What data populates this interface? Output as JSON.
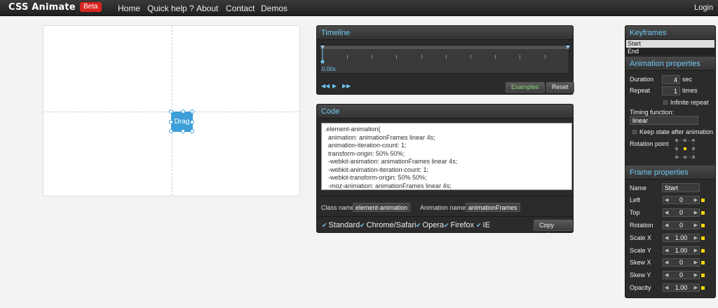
{
  "header": {
    "logo": "CSS Animate",
    "badge": "Beta",
    "nav": [
      "Home",
      "Quick help ?",
      "About",
      "Contact",
      "Demos"
    ],
    "login": "Login"
  },
  "stage": {
    "drag_label": "Drag"
  },
  "timeline": {
    "title": "Timeline",
    "time": "0.00s",
    "examples_label": "Examples",
    "reset_label": "Reset",
    "icons": [
      "rewind-icon",
      "play-icon",
      "fast-forward-icon"
    ]
  },
  "code": {
    "title": "Code",
    "text": ".element-animation{\n  animation: animationFrames linear 4s;\n  animation-iteration-count: 1;\n  transform-origin: 50% 50%;\n  -webkit-animation: animationFrames linear 4s;\n  -webkit-animation-iteration-count: 1;\n  -webkit-transform-origin: 50% 50%;\n  -moz-animation: animationFrames linear 4s;",
    "class_name_label": "Class name",
    "class_name_value": "element-animation",
    "animation_name_label": "Animation name",
    "animation_name_value": "animationFrames",
    "checks": [
      "Standard",
      "Chrome/Safari",
      "Opera",
      "Firefox",
      "IE"
    ],
    "copy_label": "Copy code"
  },
  "keyframes": {
    "title": "Keyframes",
    "items": [
      "Start",
      "End"
    ]
  },
  "animation_properties": {
    "title": "Animation properties",
    "duration_label": "Duration",
    "duration_value": "4",
    "duration_unit": "sec",
    "repeat_label": "Repeat",
    "repeat_value": "1",
    "repeat_unit": "times",
    "infinite_label": "Infinite repeat",
    "timing_label": "Timing function:",
    "timing_value": "linear",
    "keep_state_label": "Keep state after animation",
    "rotation_point_label": "Rotation point"
  },
  "frame_properties": {
    "title": "Frame properties",
    "name_label": "Name",
    "name_value": "Start",
    "rows": [
      {
        "label": "Left",
        "value": "0"
      },
      {
        "label": "Top",
        "value": "0"
      },
      {
        "label": "Rotation",
        "value": "0"
      },
      {
        "label": "Scale X",
        "value": "1.00"
      },
      {
        "label": "Scale Y",
        "value": "1.00"
      },
      {
        "label": "Skew X",
        "value": "0"
      },
      {
        "label": "Skew Y",
        "value": "0"
      },
      {
        "label": "Opacity",
        "value": "1.00"
      }
    ]
  },
  "colors": {
    "accent": "#6ec6f0",
    "beta": "#d8241f",
    "element": "#3d9fd8",
    "marker": "#f5d300"
  }
}
